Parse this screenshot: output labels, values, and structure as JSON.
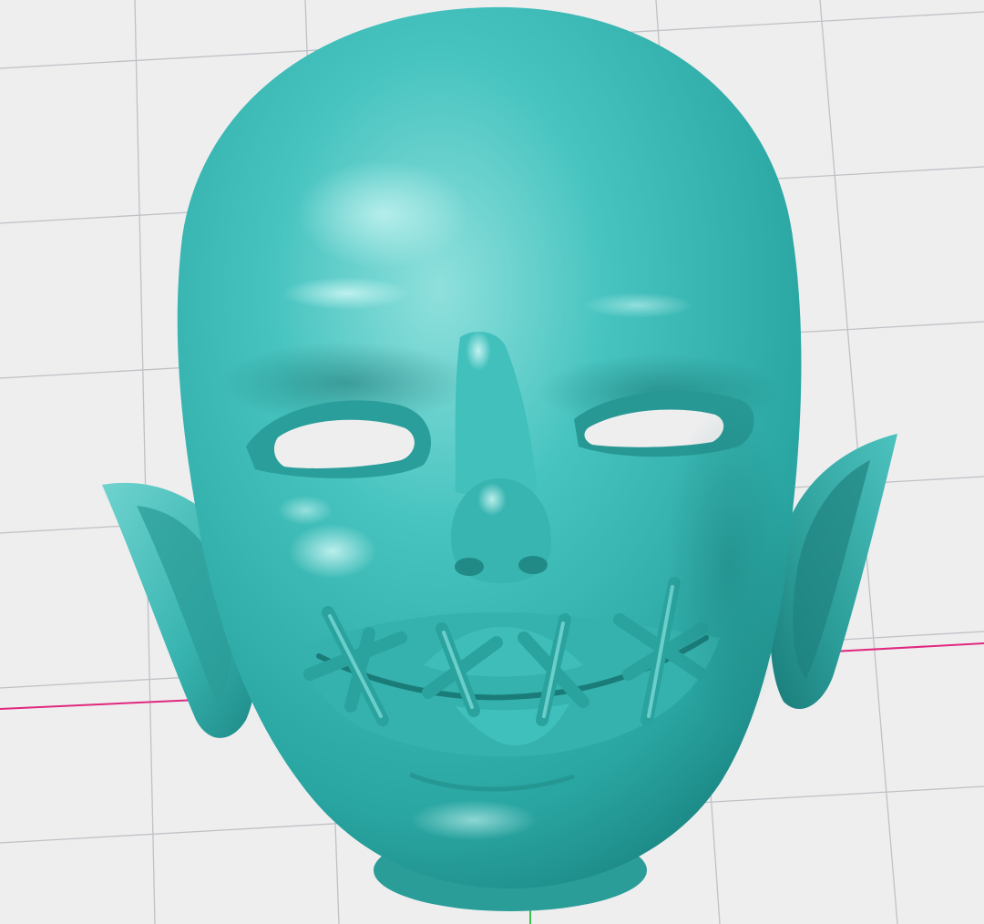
{
  "viewport": {
    "background_color": "#eeeeef",
    "grid_line_color": "#bfc1c5",
    "x_axis_color": "#e0287e",
    "y_axis_color": "#3cc24a"
  },
  "model": {
    "subject": "stitched-mouth-elf-mask",
    "material_color": "#3dbdb9",
    "highlight_color": "#9fe8e4",
    "shadow_color": "#1a7f7c",
    "eye_hole_color": "#eeeeef"
  },
  "icons": {
    "model": "mask-model-icon"
  }
}
